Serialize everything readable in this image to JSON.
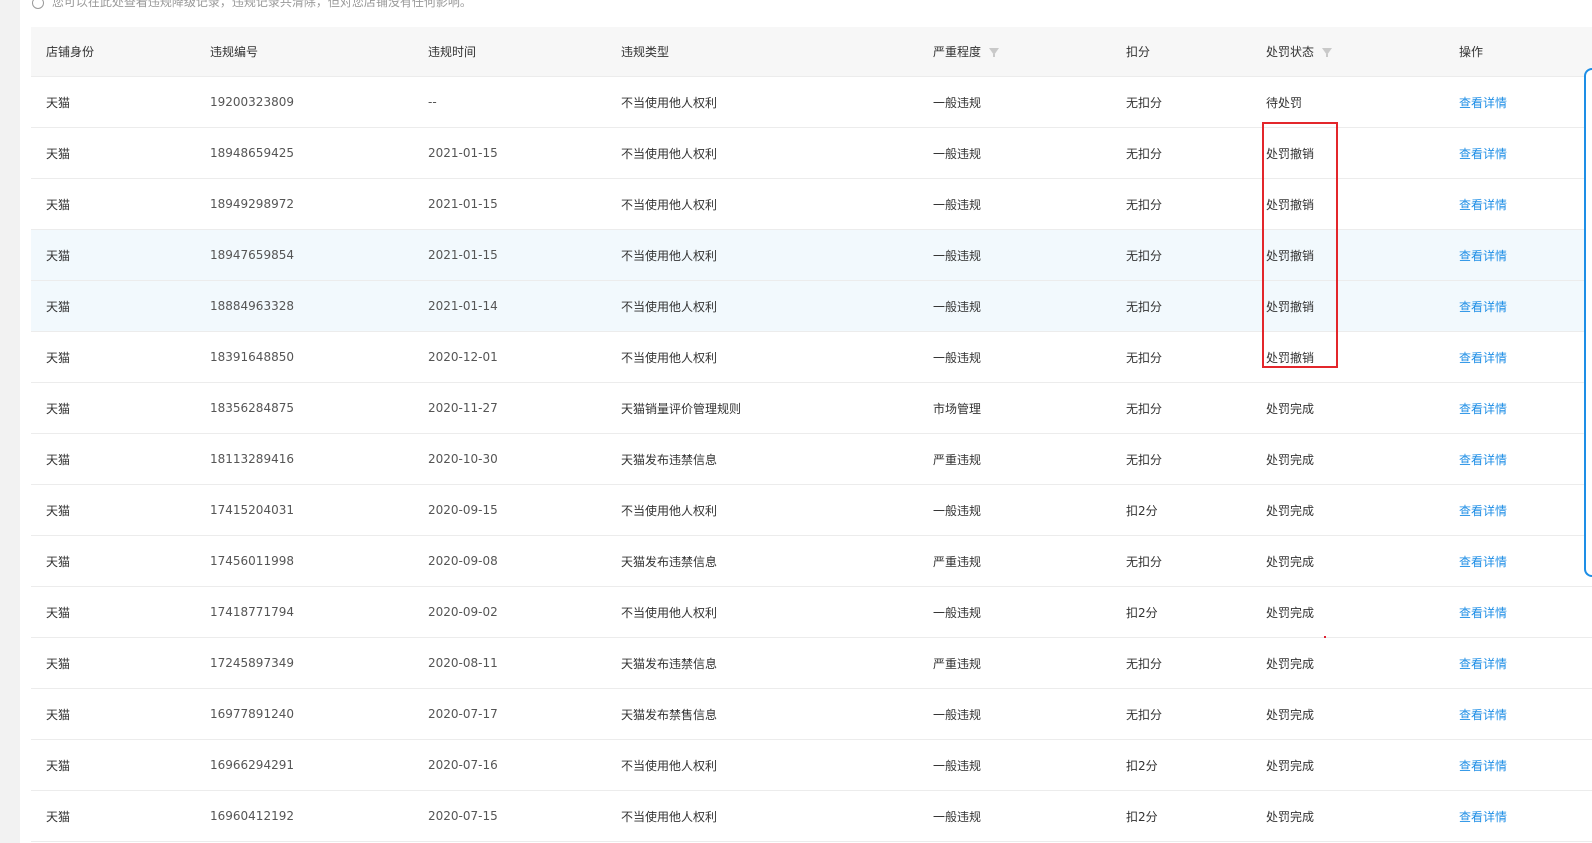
{
  "notice": "您可以在此处查看违规降级记录，违规记录共清除，但对您店铺没有任何影响。",
  "columns": [
    "店铺身份",
    "违规编号",
    "违规时间",
    "违规类型",
    "严重程度",
    "扣分",
    "处罚状态",
    "操作"
  ],
  "rows": [
    {
      "shop": "天猫",
      "id": "19200323809",
      "time": "--",
      "type": "不当使用他人权利",
      "severity": "一般违规",
      "points": "无扣分",
      "status": "待处罚",
      "action": "查看详情"
    },
    {
      "shop": "天猫",
      "id": "18948659425",
      "time": "2021-01-15",
      "type": "不当使用他人权利",
      "severity": "一般违规",
      "points": "无扣分",
      "status": "处罚撤销",
      "action": "查看详情"
    },
    {
      "shop": "天猫",
      "id": "18949298972",
      "time": "2021-01-15",
      "type": "不当使用他人权利",
      "severity": "一般违规",
      "points": "无扣分",
      "status": "处罚撤销",
      "action": "查看详情"
    },
    {
      "shop": "天猫",
      "id": "18947659854",
      "time": "2021-01-15",
      "type": "不当使用他人权利",
      "severity": "一般违规",
      "points": "无扣分",
      "status": "处罚撤销",
      "action": "查看详情"
    },
    {
      "shop": "天猫",
      "id": "18884963328",
      "time": "2021-01-14",
      "type": "不当使用他人权利",
      "severity": "一般违规",
      "points": "无扣分",
      "status": "处罚撤销",
      "action": "查看详情"
    },
    {
      "shop": "天猫",
      "id": "18391648850",
      "time": "2020-12-01",
      "type": "不当使用他人权利",
      "severity": "一般违规",
      "points": "无扣分",
      "status": "处罚撤销",
      "action": "查看详情"
    },
    {
      "shop": "天猫",
      "id": "18356284875",
      "time": "2020-11-27",
      "type": "天猫销量评价管理规则",
      "severity": "市场管理",
      "points": "无扣分",
      "status": "处罚完成",
      "action": "查看详情"
    },
    {
      "shop": "天猫",
      "id": "18113289416",
      "time": "2020-10-30",
      "type": "天猫发布违禁信息",
      "severity": "严重违规",
      "points": "无扣分",
      "status": "处罚完成",
      "action": "查看详情"
    },
    {
      "shop": "天猫",
      "id": "17415204031",
      "time": "2020-09-15",
      "type": "不当使用他人权利",
      "severity": "一般违规",
      "points": "扣2分",
      "status": "处罚完成",
      "action": "查看详情"
    },
    {
      "shop": "天猫",
      "id": "17456011998",
      "time": "2020-09-08",
      "type": "天猫发布违禁信息",
      "severity": "严重违规",
      "points": "无扣分",
      "status": "处罚完成",
      "action": "查看详情"
    },
    {
      "shop": "天猫",
      "id": "17418771794",
      "time": "2020-09-02",
      "type": "不当使用他人权利",
      "severity": "一般违规",
      "points": "扣2分",
      "status": "处罚完成",
      "action": "查看详情"
    },
    {
      "shop": "天猫",
      "id": "17245897349",
      "time": "2020-08-11",
      "type": "天猫发布违禁信息",
      "severity": "严重违规",
      "points": "无扣分",
      "status": "处罚完成",
      "action": "查看详情"
    },
    {
      "shop": "天猫",
      "id": "16977891240",
      "time": "2020-07-17",
      "type": "天猫发布禁售信息",
      "severity": "一般违规",
      "points": "无扣分",
      "status": "处罚完成",
      "action": "查看详情"
    },
    {
      "shop": "天猫",
      "id": "16966294291",
      "time": "2020-07-16",
      "type": "不当使用他人权利",
      "severity": "一般违规",
      "points": "扣2分",
      "status": "处罚完成",
      "action": "查看详情"
    },
    {
      "shop": "天猫",
      "id": "16960412192",
      "time": "2020-07-15",
      "type": "不当使用他人权利",
      "severity": "一般违规",
      "points": "扣2分",
      "status": "处罚完成",
      "action": "查看详情"
    }
  ],
  "highlighted_rows": [
    3,
    4
  ],
  "colors": {
    "link": "#1e8ee6",
    "annotation": "#e3262b",
    "row_highlight": "#f2f9fd"
  }
}
